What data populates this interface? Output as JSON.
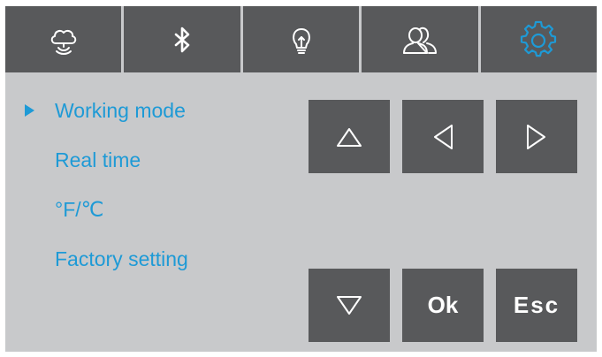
{
  "tabs": [
    {
      "icon": "cloud-icon"
    },
    {
      "icon": "bluetooth-icon"
    },
    {
      "icon": "lightbulb-icon"
    },
    {
      "icon": "users-icon"
    },
    {
      "icon": "gear-icon"
    }
  ],
  "active_tab": "gear-icon",
  "menu": {
    "items": [
      {
        "label": "Working mode",
        "selected": true
      },
      {
        "label": "Real time",
        "selected": false
      },
      {
        "label": "°F/℃",
        "selected": false
      },
      {
        "label": "Factory setting",
        "selected": false
      }
    ]
  },
  "keys": {
    "up_icon": "triangle-up-icon",
    "left_icon": "triangle-left-icon",
    "right_icon": "triangle-right-icon",
    "down_icon": "triangle-down-icon",
    "ok_label": "Ok",
    "esc_label": "Esc"
  },
  "colors": {
    "panel_bg": "#c8c9cb",
    "key_bg": "#58595b",
    "accent": "#1e9ad6",
    "icon": "#ffffff"
  }
}
